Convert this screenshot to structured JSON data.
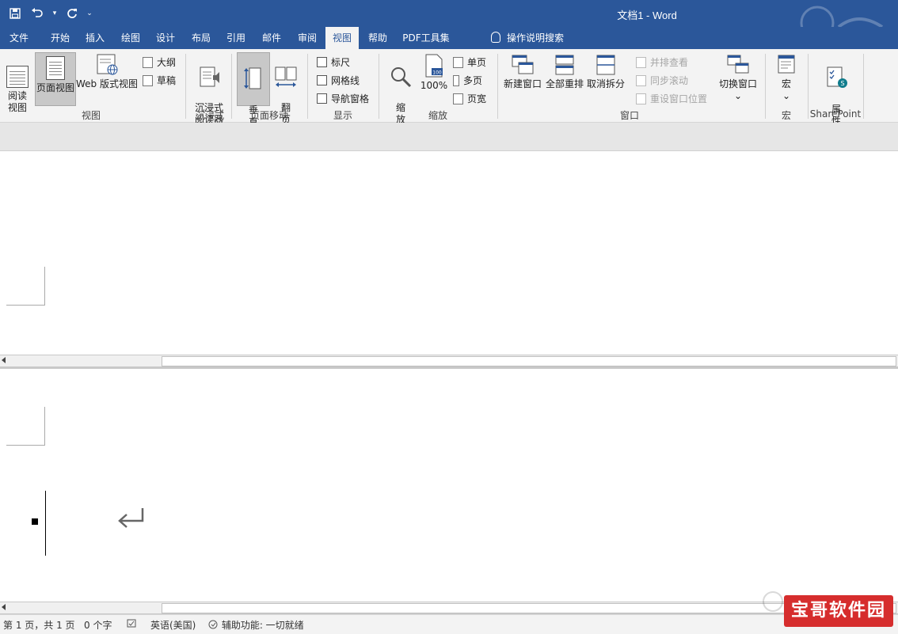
{
  "title": "文档1  -  Word",
  "qat": {
    "save": "save-icon",
    "undo": "undo-icon",
    "redo": "redo-icon",
    "customize": "customize-icon"
  },
  "tabs": [
    "文件",
    "开始",
    "插入",
    "绘图",
    "设计",
    "布局",
    "引用",
    "邮件",
    "审阅",
    "视图",
    "帮助",
    "PDF工具集"
  ],
  "active_tab": "视图",
  "tell_me": "操作说明搜索",
  "ribbon": {
    "view": {
      "label": "视图",
      "read_mode": "阅读\n视图",
      "print_layout": "页面视图",
      "web_layout": "Web 版式视图",
      "outline": "大纲",
      "draft": "草稿"
    },
    "immersive": {
      "label": "沉浸式",
      "reader": "沉浸式\n阅读器"
    },
    "page_movement": {
      "label": "页面移动",
      "vertical": "垂\n直",
      "side_to_side": "翻\n页"
    },
    "show": {
      "label": "显示",
      "ruler": "标尺",
      "gridlines": "网格线",
      "nav_pane": "导航窗格"
    },
    "zoom": {
      "label": "缩放",
      "zoom": "缩\n放",
      "hundred": "100%",
      "one_page": "单页",
      "multiple_pages": "多页",
      "page_width": "页宽",
      "badge": "100"
    },
    "window": {
      "label": "窗口",
      "new_window": "新建窗口",
      "arrange_all": "全部重排",
      "remove_split": "取消拆分",
      "side_by_side": "并排查看",
      "sync_scroll": "同步滚动",
      "reset_position": "重设窗口位置",
      "switch_windows": "切换窗口",
      "chevron": "⌄"
    },
    "macros": {
      "label": "宏",
      "macros": "宏",
      "chevron": "⌄"
    },
    "sharepoint": {
      "label": "SharePoint",
      "properties": "属\n性"
    }
  },
  "status": {
    "page": "第 1 页，共 1 页",
    "words": "0 个字",
    "language": "英语(美国)",
    "accessibility": "辅助功能: 一切就绪"
  },
  "watermark": "宝哥软件园"
}
